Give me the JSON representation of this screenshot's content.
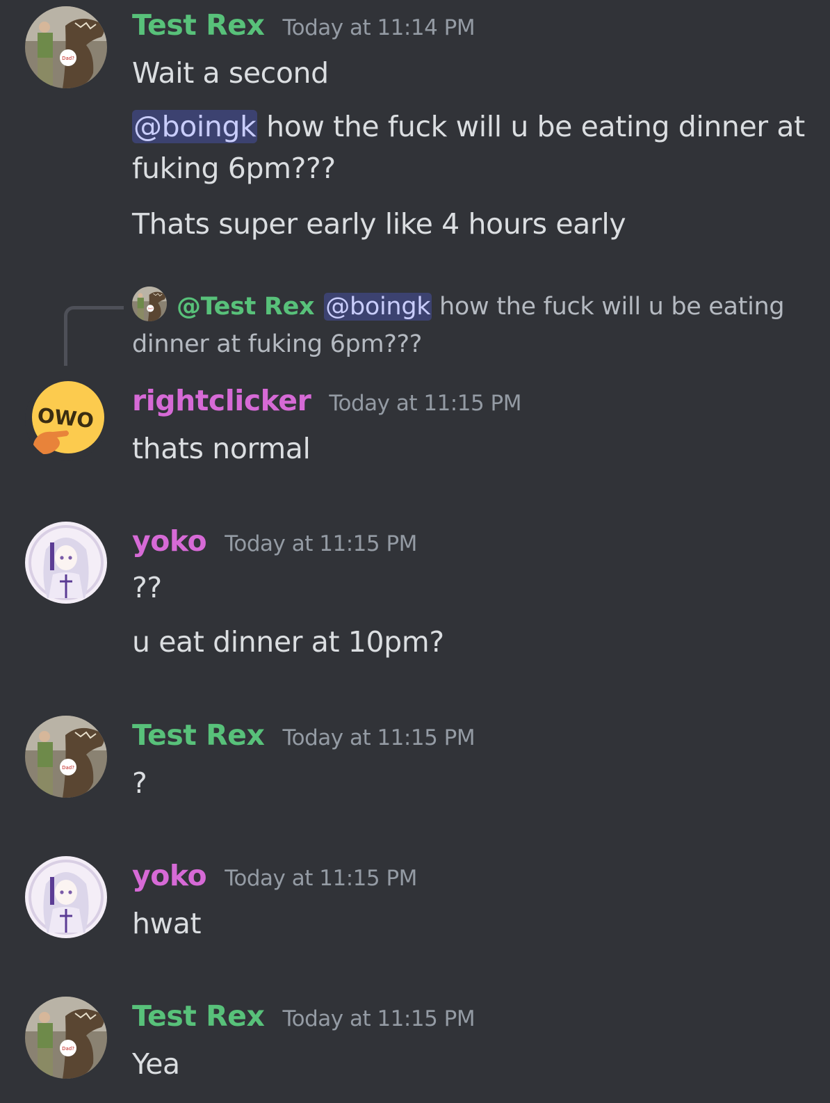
{
  "colors": {
    "background": "#313338",
    "test_rex": "#58c17a",
    "pink_role": "#d66ad6",
    "timestamp": "#949ba4",
    "mention_bg": "#3c4270",
    "mention_text": "#c9cdfb"
  },
  "messages": [
    {
      "username": "Test Rex",
      "timestamp": "Today at 11:14 PM",
      "lines": [
        "Wait a second",
        "how the fuck will u be eating dinner at fuking 6pm???",
        "Thats super early like 4 hours early"
      ],
      "mention": "@boingk"
    },
    {
      "reply": {
        "username": "@Test Rex",
        "mention": "@boingk",
        "text": "how the fuck will u be eating dinner at fuking 6pm???"
      },
      "username": "rightclicker",
      "timestamp": "Today at 11:15 PM",
      "lines": [
        "thats normal"
      ]
    },
    {
      "username": "yoko",
      "timestamp": "Today at 11:15 PM",
      "lines": [
        "??",
        "u eat dinner at 10pm?"
      ]
    },
    {
      "username": "Test Rex",
      "timestamp": "Today at 11:15 PM",
      "lines": [
        "?"
      ]
    },
    {
      "username": "yoko",
      "timestamp": "Today at 11:15 PM",
      "lines": [
        "hwat"
      ]
    },
    {
      "username": "Test Rex",
      "timestamp": "Today at 11:15 PM",
      "lines": [
        "Yea"
      ]
    }
  ]
}
